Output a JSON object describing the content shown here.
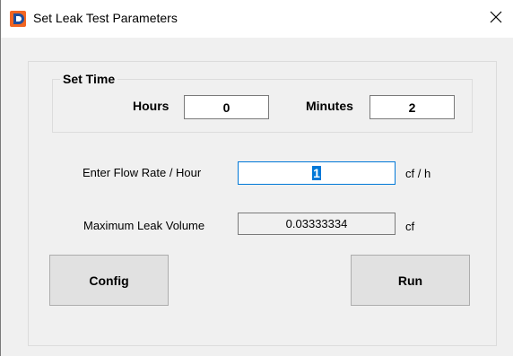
{
  "window": {
    "title": "Set Leak Test Parameters",
    "close_glyph": "✕"
  },
  "set_time": {
    "legend": "Set Time",
    "hours_label": "Hours",
    "hours_value": "0",
    "minutes_label": "Minutes",
    "minutes_value": "2"
  },
  "flow_rate": {
    "label": "Enter Flow Rate / Hour",
    "value": "1",
    "unit": "cf / h"
  },
  "max_leak": {
    "label": "Maximum Leak Volume",
    "value": "0.03333334",
    "unit": "cf"
  },
  "buttons": {
    "config_label": "Config",
    "run_label": "Run"
  },
  "icons": {
    "app": "app-logo-icon",
    "close": "close-icon"
  },
  "colors": {
    "accent": "#0078d7",
    "logo_orange": "#f26522",
    "logo_blue": "#1f4e9c",
    "button_face": "#e1e1e1",
    "dialog_bg": "#f0f0f0"
  }
}
